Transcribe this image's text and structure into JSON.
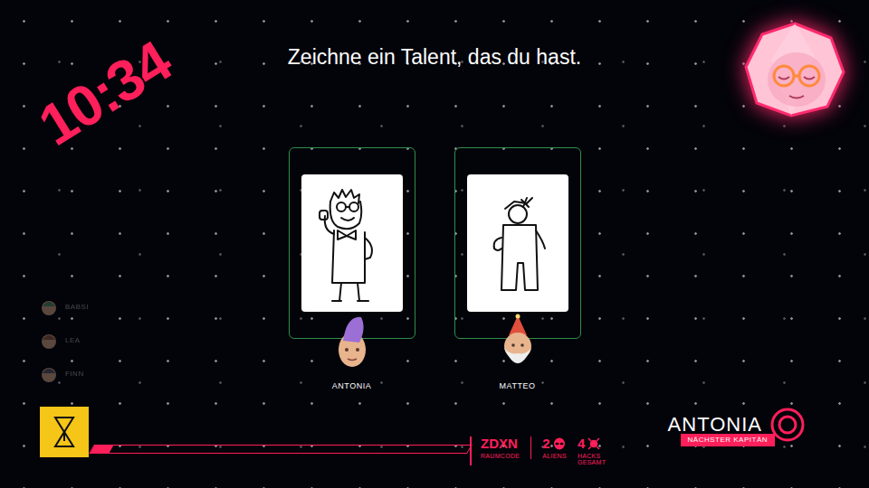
{
  "timer": "10:34",
  "prompt": "Zeichne ein Talent, das du hast.",
  "players": [
    {
      "name": "BABSI",
      "submitted": false,
      "color": "#3f7a52"
    },
    {
      "name": "LEA",
      "submitted": false,
      "color": "#7a4a3a"
    },
    {
      "name": "FINN",
      "submitted": false,
      "color": "#4a4a5a"
    }
  ],
  "submissions": [
    {
      "player": "ANTONIA",
      "avatar": "mohawk",
      "color": "#9b6fd6",
      "drawing": "singer"
    },
    {
      "player": "MATTEO",
      "avatar": "hat",
      "color": "#e0503c",
      "drawing": "figure"
    }
  ],
  "progress": {
    "level": 0.05
  },
  "captain": {
    "name": "ANTONIA",
    "label": "NÄCHSTER KAPITÄN"
  },
  "stats": [
    {
      "value": "ZDXN",
      "label": "RAUMCODE",
      "kind": "code"
    },
    {
      "value": "2",
      "label": "ALIENS",
      "kind": "alien"
    },
    {
      "value": "4",
      "label": "HACKS GESAMT",
      "kind": "hack"
    }
  ]
}
